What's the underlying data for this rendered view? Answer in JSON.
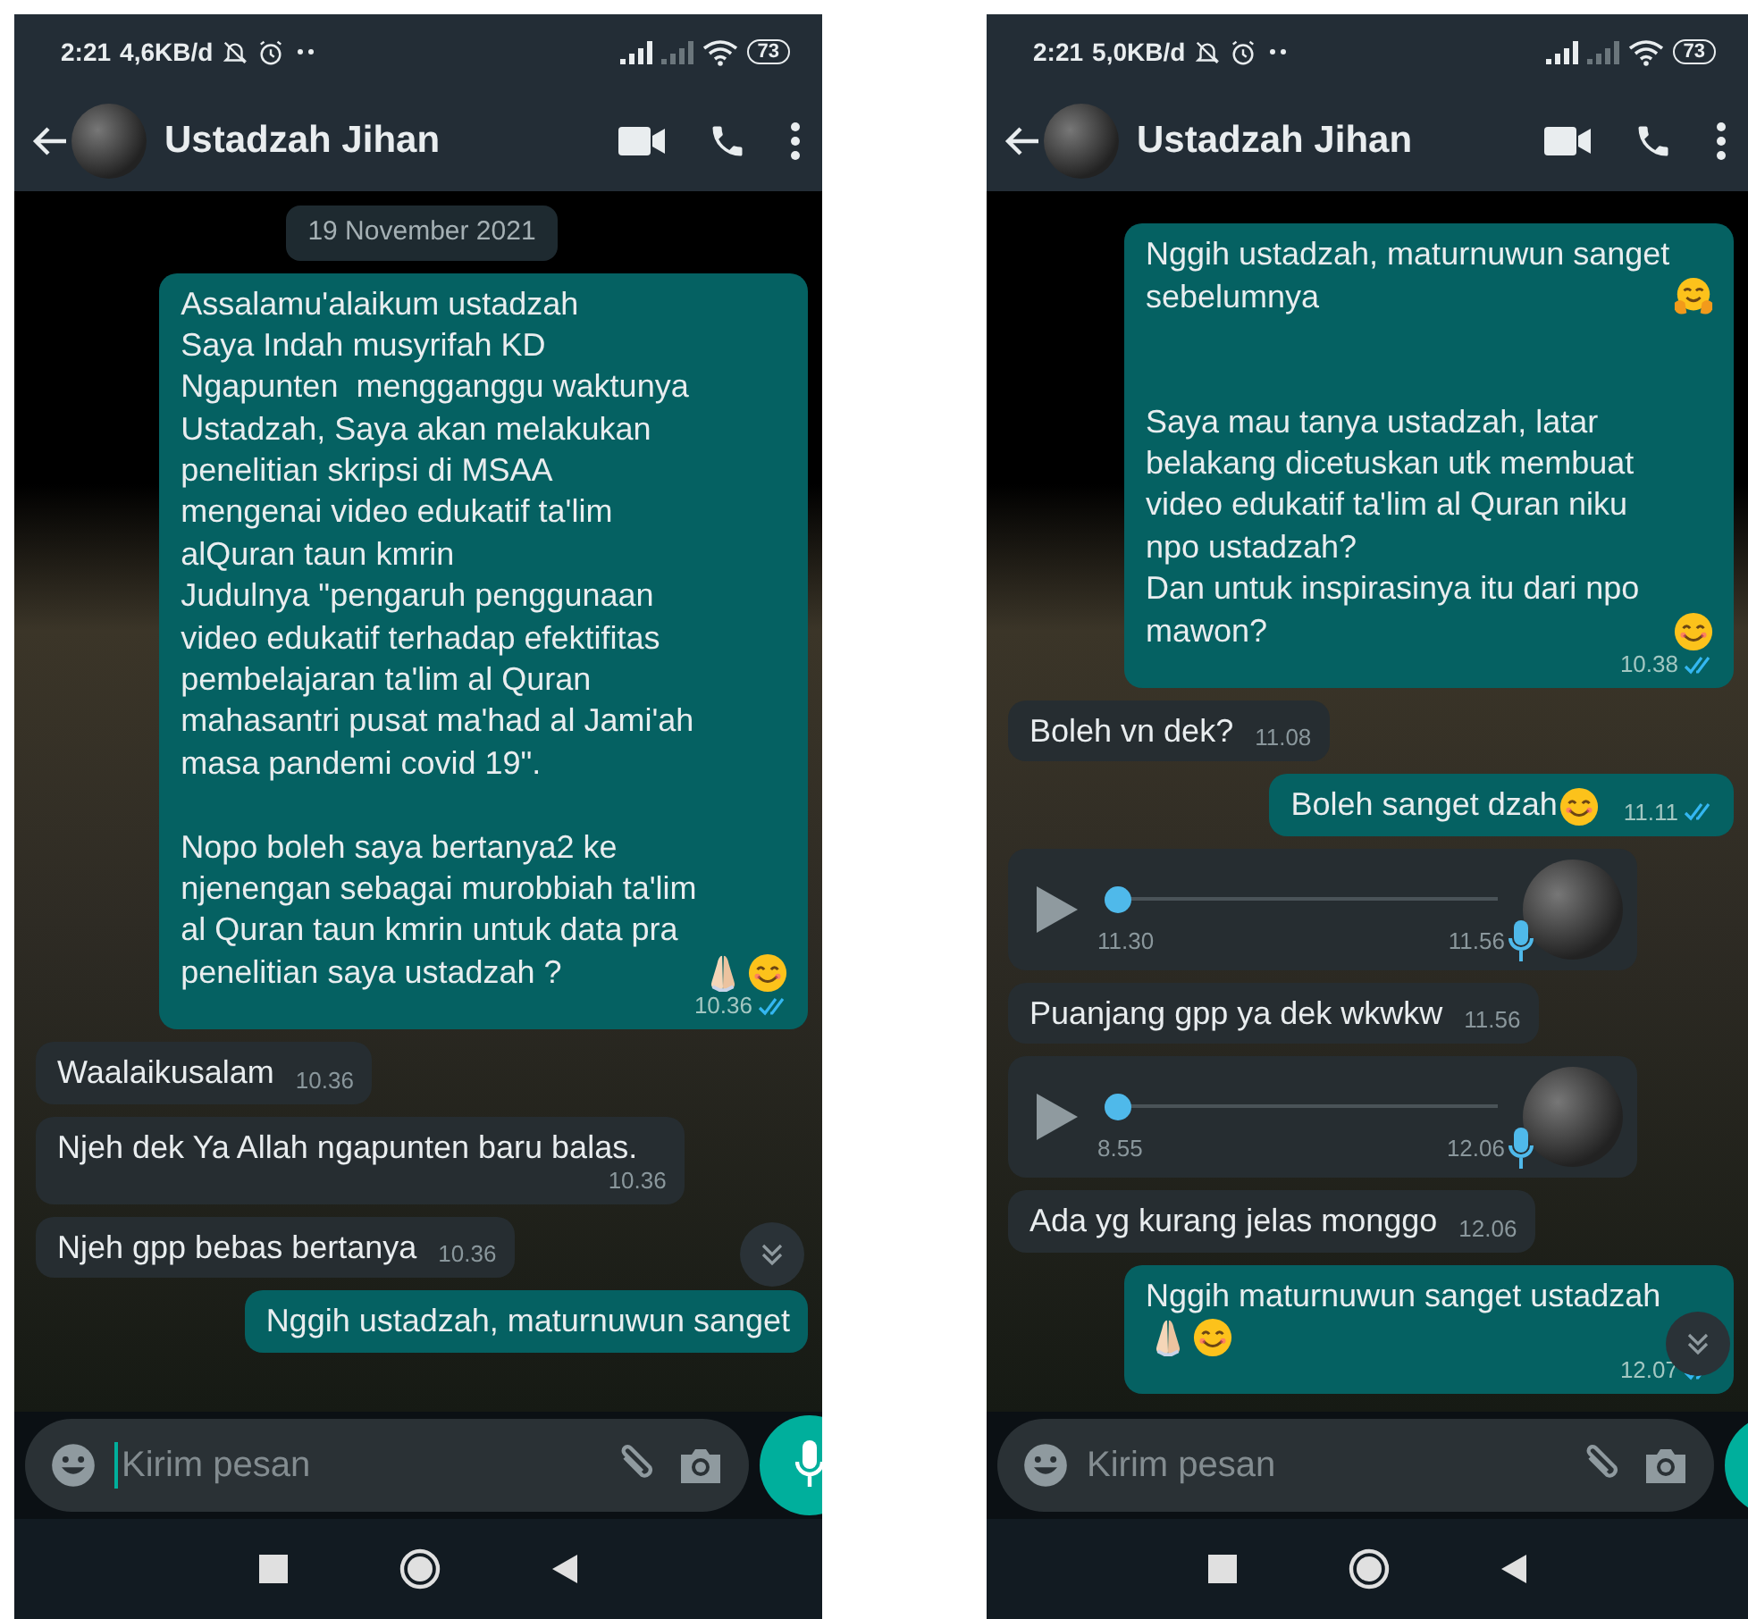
{
  "phones": [
    {
      "status_bar": {
        "time": "2:21",
        "speed": "4,6KB/d",
        "battery": "73"
      },
      "contact": "Ustadzah Jihan",
      "date_chip": "19 November 2021",
      "messages": [
        {
          "kind": "text",
          "outgoing": true,
          "parts": [
            {
              "kind": "text",
              "text": "Assalamu'alaikum ustadzah\nSaya Indah musyrifah KD\nNgapunten  mengganggu waktunya Ustadzah, Saya akan melakukan penelitian skripsi di MSAA mengenai video edukatif ta'lim alQuran taun kmrin\nJudulnya \"pengaruh penggunaan video edukatif terhadap efektifitas pembelajaran ta'lim al Quran mahasantri pusat ma'had al Jami'ah masa pandemi covid 19\".\n\nNopo boleh saya bertanya2 ke njenengan sebagai murobbiah ta'lim al Quran taun kmrin untuk data pra penelitian saya ustadzah ?"
            },
            {
              "kind": "pray"
            },
            {
              "kind": "smile"
            }
          ],
          "time": "10.36",
          "read": true
        },
        {
          "kind": "text",
          "outgoing": false,
          "parts": [
            {
              "kind": "text",
              "text": "Waalaikusalam"
            }
          ],
          "time": "10.36"
        },
        {
          "kind": "text",
          "outgoing": false,
          "parts": [
            {
              "kind": "text",
              "text": "Njeh dek Ya Allah ngapunten baru balas."
            }
          ],
          "time": "10.36"
        },
        {
          "kind": "text",
          "outgoing": false,
          "parts": [
            {
              "kind": "text",
              "text": "Njeh gpp bebas bertanya"
            }
          ],
          "time": "10.36"
        },
        {
          "kind": "text",
          "outgoing": true,
          "parts": [
            {
              "kind": "text",
              "text": "Nggih ustadzah, maturnuwun sanget"
            }
          ]
        }
      ],
      "input": {
        "placeholder": "Kirim pesan",
        "focused": true
      }
    },
    {
      "status_bar": {
        "time": "2:21",
        "speed": "5,0KB/d",
        "battery": "73"
      },
      "contact": "Ustadzah Jihan",
      "messages": [
        {
          "kind": "text",
          "outgoing": true,
          "parts": [
            {
              "kind": "text",
              "text": "Nggih ustadzah, maturnuwun sanget sebelumnya"
            },
            {
              "kind": "hug"
            },
            {
              "kind": "text",
              "text": "\n\nSaya mau tanya ustadzah, latar belakang dicetuskan utk membuat video edukatif ta'lim al Quran niku npo ustadzah?\nDan untuk inspirasinya itu dari npo mawon?"
            },
            {
              "kind": "smile"
            }
          ],
          "time": "10.38",
          "read": true
        },
        {
          "kind": "text",
          "outgoing": false,
          "parts": [
            {
              "kind": "text",
              "text": "Boleh vn dek?"
            }
          ],
          "time": "11.08"
        },
        {
          "kind": "text",
          "outgoing": true,
          "parts": [
            {
              "kind": "text",
              "text": "Boleh sanget dzah"
            },
            {
              "kind": "smile"
            }
          ],
          "time": "11.11",
          "read": true
        },
        {
          "kind": "voice",
          "outgoing": false,
          "duration": "11.30",
          "time": "11.56",
          "level": 0
        },
        {
          "kind": "text",
          "outgoing": false,
          "parts": [
            {
              "kind": "text",
              "text": "Puanjang gpp ya dek wkwkw"
            }
          ],
          "time": "11.56"
        },
        {
          "kind": "voice",
          "outgoing": false,
          "duration": "8.55",
          "time": "12.06",
          "level": 0
        },
        {
          "kind": "text",
          "outgoing": false,
          "parts": [
            {
              "kind": "text",
              "text": "Ada yg kurang jelas monggo"
            }
          ],
          "time": "12.06"
        },
        {
          "kind": "text",
          "outgoing": true,
          "parts": [
            {
              "kind": "text",
              "text": "Nggih maturnuwun sanget ustadzah\n"
            },
            {
              "kind": "pray"
            },
            {
              "kind": "smile"
            }
          ],
          "time": "12.07",
          "read": true
        }
      ],
      "input": {
        "placeholder": "Kirim pesan",
        "focused": false
      }
    }
  ]
}
